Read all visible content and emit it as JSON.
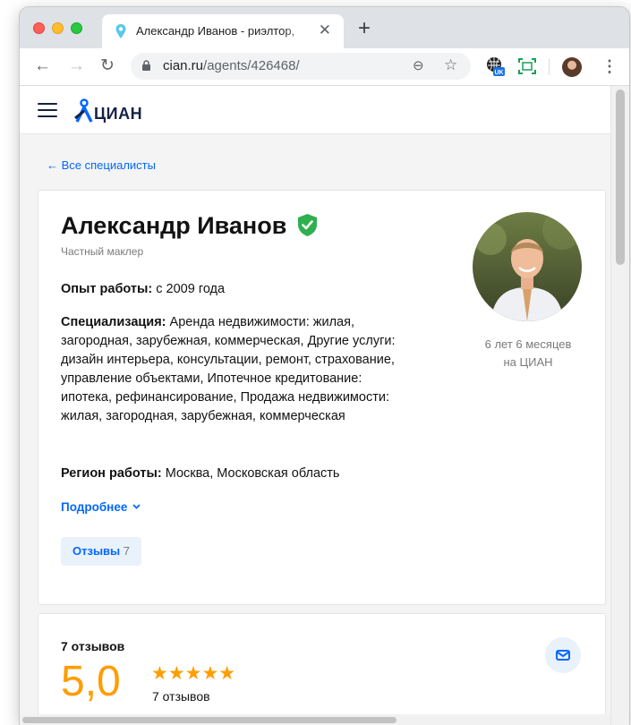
{
  "browser": {
    "tab_title": "Александр Иванов - риэлтор,",
    "tab_close": "✕",
    "new_tab": "+",
    "url_host": "cian.ru",
    "url_path": "/agents/426468/",
    "extension_badge": "UK",
    "nav": {
      "back": "←",
      "forward": "→",
      "reload": "↻"
    },
    "omnibox_icons": [
      "zoom-icon",
      "bookmark-star-icon"
    ],
    "zoom_glyph": "⊖",
    "star_glyph": "☆",
    "menu_glyph": "⋮"
  },
  "site": {
    "logo_text": "ЦИАН",
    "back_link": "← Все специалисты"
  },
  "agent": {
    "name": "Александр Иванов",
    "type": "Частный маклер",
    "experience_label": "Опыт работы:",
    "experience_value": " с 2009 года",
    "specialization_label": "Специализация:",
    "specialization_value": " Аренда недвижимости: жилая, загородная, зарубежная, коммерческая, Другие услуги: дизайн интерьера, консультации, ремонт, страхование, управление объектами, Ипотечное кредитование: ипотека, рефинансирование, Продажа недвижимости: жилая, загородная, зарубежная, коммерческая",
    "region_label": "Регион работы:",
    "region_value": " Москва, Московская область",
    "more_link": "Подробнее",
    "reviews_pill_label": "Отзывы",
    "reviews_pill_count": "7",
    "tenure_line1": "6 лет 6 месяцев",
    "tenure_line2": "на ЦИАН"
  },
  "reviews": {
    "title": "7 отзывов",
    "score": "5,0",
    "stars": "★★★★★",
    "rating_fraction": 1.0,
    "count_text": "7 отзывов"
  },
  "colors": {
    "accent_blue": "#0468ff",
    "rating_orange": "#ff9d00",
    "verified_green": "#2fb050"
  }
}
